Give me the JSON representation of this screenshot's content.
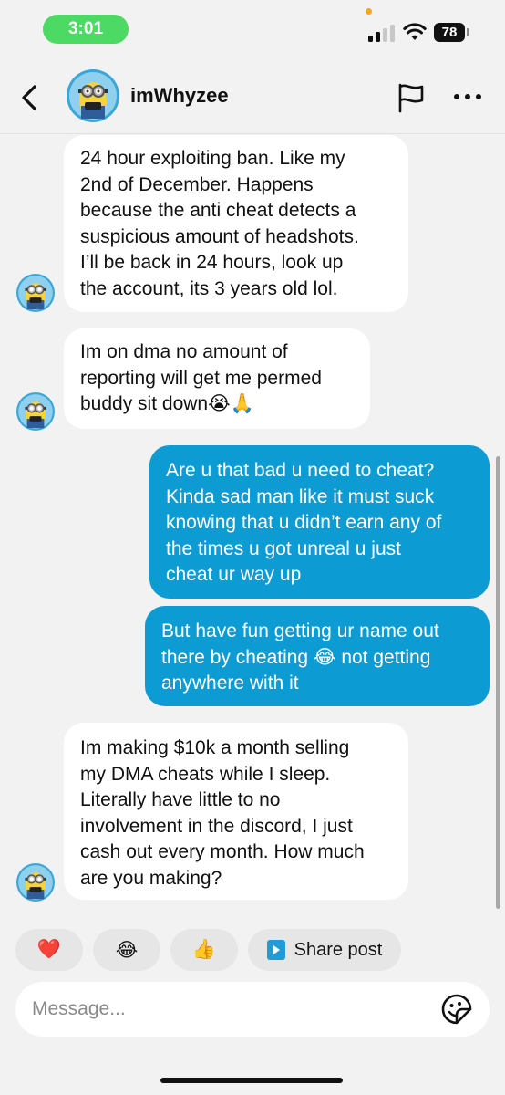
{
  "status_bar": {
    "time": "3:01",
    "battery": "78"
  },
  "header": {
    "username": "imWhyzee"
  },
  "messages": [
    {
      "from": "received",
      "text": "24 hour exploiting ban. Like my\n2nd of December. Happens\nbecause the anti cheat detects a\nsuspicious amount of headshots.\nI’ll be back in 24 hours, look up\nthe account, its 3 years old lol."
    },
    {
      "from": "received",
      "text": "Im on dma no amount of\nreporting will get me permed\nbuddy sit down😭🙏"
    },
    {
      "from": "sent",
      "text": "Are u that bad u need to cheat?\nKinda sad man like it must suck\nknowing that u didn’t earn any of\nthe times u got unreal u just\ncheat ur way up"
    },
    {
      "from": "sent",
      "text": "But have fun getting ur name out\nthere by cheating 😂 not getting\nanywhere with it"
    },
    {
      "from": "received",
      "text": "Im making $10k a month selling\nmy DMA cheats while I sleep.\nLiterally have little to no\ninvolvement in the discord, I just\ncash out every month. How much\nare you making?"
    }
  ],
  "quick_reactions": [
    "❤️",
    "😂",
    "👍"
  ],
  "share_post": {
    "label": "Share post"
  },
  "composer": {
    "placeholder": "Message..."
  },
  "colors": {
    "sent_bubble": "#0d9bd4",
    "received_bubble": "#ffffff",
    "background": "#f2f2f2",
    "time_pill": "#4cd964"
  }
}
